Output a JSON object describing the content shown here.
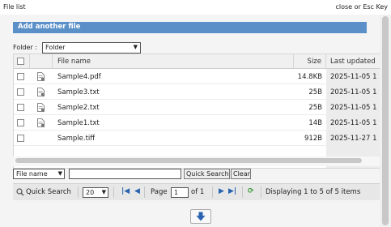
{
  "titlebar": {
    "title": "File list",
    "close": "close or Esc Key"
  },
  "panel": {
    "header": "Add another file",
    "folder_label": "Folder :",
    "folder_value": "Folder"
  },
  "columns": {
    "name": "File name",
    "size": "Size",
    "updated": "Last updated"
  },
  "files": [
    {
      "name": "Sample4.pdf",
      "size": "14.8KB",
      "updated": "2025-11-05 1",
      "icon": "file-link-icon"
    },
    {
      "name": "Sample3.txt",
      "size": "25B",
      "updated": "2025-11-05 1",
      "icon": "file-link-icon"
    },
    {
      "name": "Sample2.txt",
      "size": "25B",
      "updated": "2025-11-05 1",
      "icon": "file-link-icon"
    },
    {
      "name": "Sample1.txt",
      "size": "14B",
      "updated": "2025-11-05 1",
      "icon": "file-link-icon"
    },
    {
      "name": "Sample.tiff",
      "size": "912B",
      "updated": "2025-11-27 1",
      "icon": ""
    }
  ],
  "search": {
    "field_select": "File name",
    "input_value": "",
    "search_button": "Quick Search",
    "clear_button": "Clear"
  },
  "pager": {
    "quick_search": "Quick Search",
    "per_page": "20",
    "page_label": "Page",
    "page_value": "1",
    "of_label": "of 1",
    "displaying": "Displaying 1 to 5 of 5 items"
  },
  "colors": {
    "header_bar": "#5a8fc8",
    "icon_blue": "#2a64b0"
  }
}
